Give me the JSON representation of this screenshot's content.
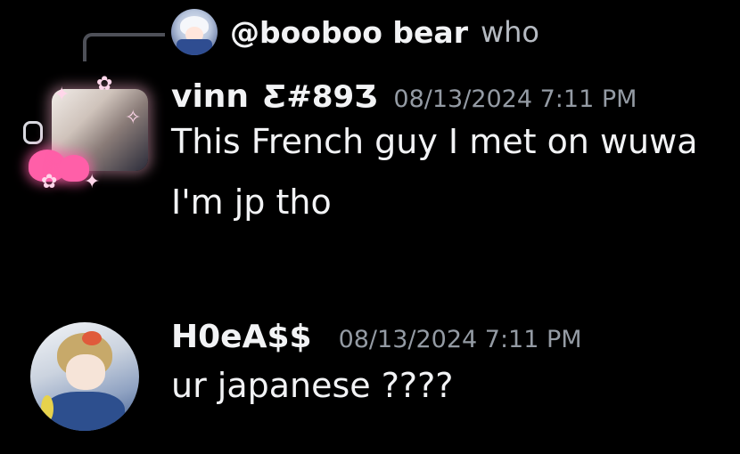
{
  "reply": {
    "username": "@booboo bear",
    "text": "who"
  },
  "messages": [
    {
      "username": "vinn",
      "tag": "Ƹ#89Ʒ",
      "timestamp": "08/13/2024 7:11 PM",
      "lines": [
        "This French guy I met on wuwa",
        "I'm jp tho"
      ]
    },
    {
      "username": "H0eA$$",
      "timestamp": "08/13/2024 7:11 PM",
      "lines": [
        "ur japanese ????"
      ]
    }
  ],
  "colors": {
    "background": "#000000",
    "text": "#f2f3f5",
    "muted": "#949ba4",
    "connector": "#4e5058"
  }
}
